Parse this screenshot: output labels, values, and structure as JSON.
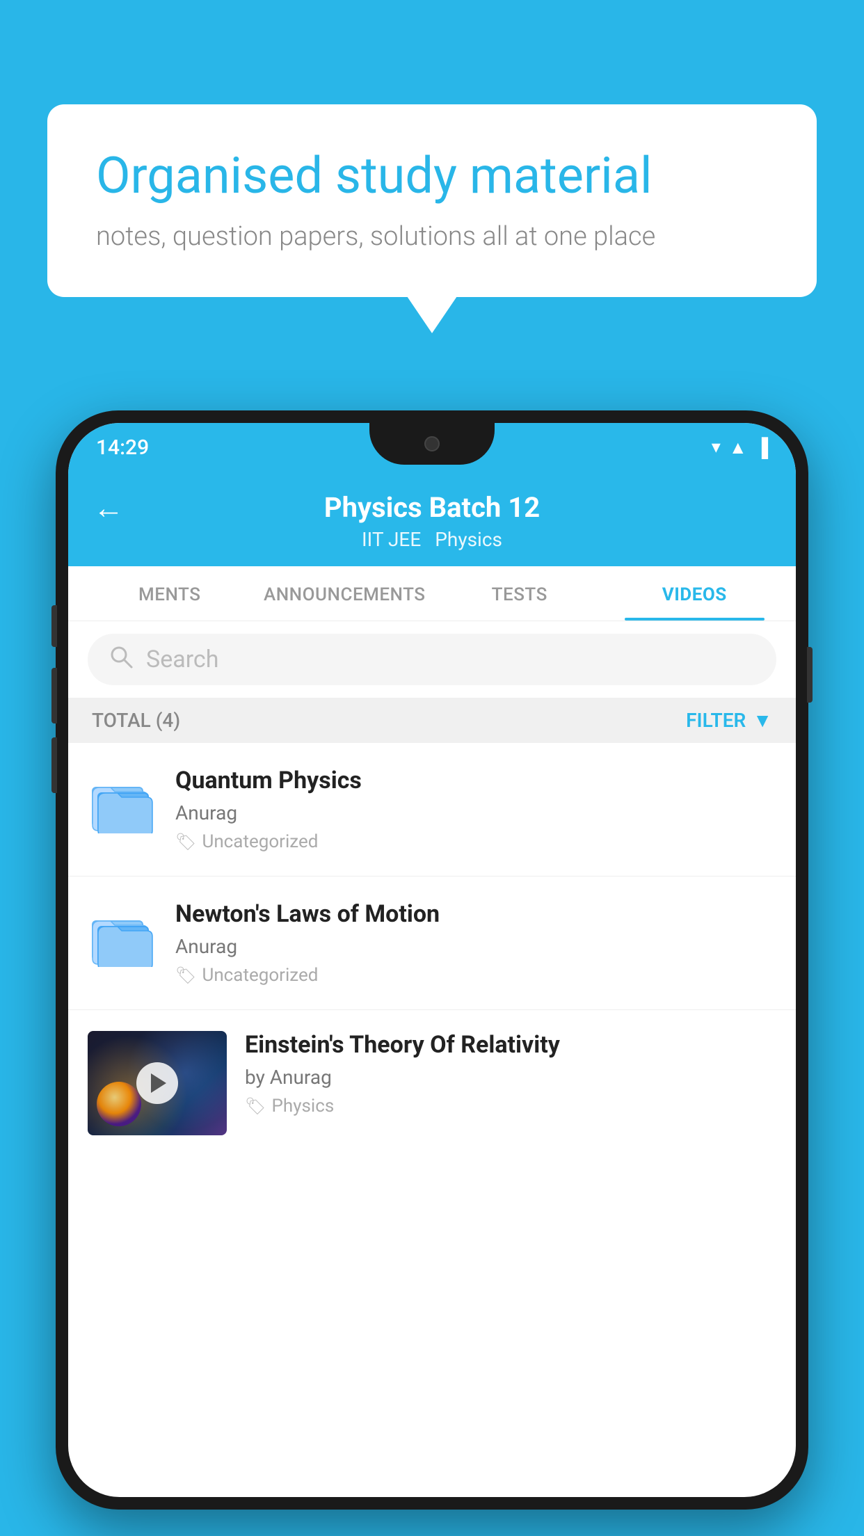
{
  "background_color": "#29B6E8",
  "speech_bubble": {
    "title": "Organised study material",
    "subtitle": "notes, question papers, solutions all at one place"
  },
  "phone": {
    "status_bar": {
      "time": "14:29"
    },
    "app_header": {
      "back_label": "←",
      "title": "Physics Batch 12",
      "subtitle_left": "IIT JEE",
      "subtitle_right": "Physics"
    },
    "tabs": [
      {
        "label": "MENTS",
        "active": false
      },
      {
        "label": "ANNOUNCEMENTS",
        "active": false
      },
      {
        "label": "TESTS",
        "active": false
      },
      {
        "label": "VIDEOS",
        "active": true
      }
    ],
    "search": {
      "placeholder": "Search"
    },
    "filter_bar": {
      "total_label": "TOTAL (4)",
      "filter_label": "FILTER"
    },
    "videos": [
      {
        "title": "Quantum Physics",
        "author": "Anurag",
        "tag": "Uncategorized",
        "type": "folder"
      },
      {
        "title": "Newton's Laws of Motion",
        "author": "Anurag",
        "tag": "Uncategorized",
        "type": "folder"
      },
      {
        "title": "Einstein's Theory Of Relativity",
        "author": "by Anurag",
        "tag": "Physics",
        "type": "video"
      }
    ]
  }
}
